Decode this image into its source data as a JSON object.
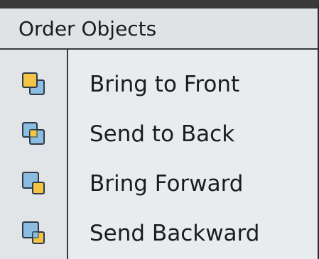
{
  "menu": {
    "title": "Order Objects",
    "items": [
      {
        "label": "Bring to Front",
        "icon": "bring-to-front-icon"
      },
      {
        "label": "Send to Back",
        "icon": "send-to-back-icon"
      },
      {
        "label": "Bring Forward",
        "icon": "bring-forward-icon"
      },
      {
        "label": "Send Backward",
        "icon": "send-backward-icon"
      }
    ]
  },
  "colors": {
    "yellow": "#f4c542",
    "blue": "#8bbde0",
    "outline": "#2e3a4a",
    "background": "#e8ecee"
  }
}
